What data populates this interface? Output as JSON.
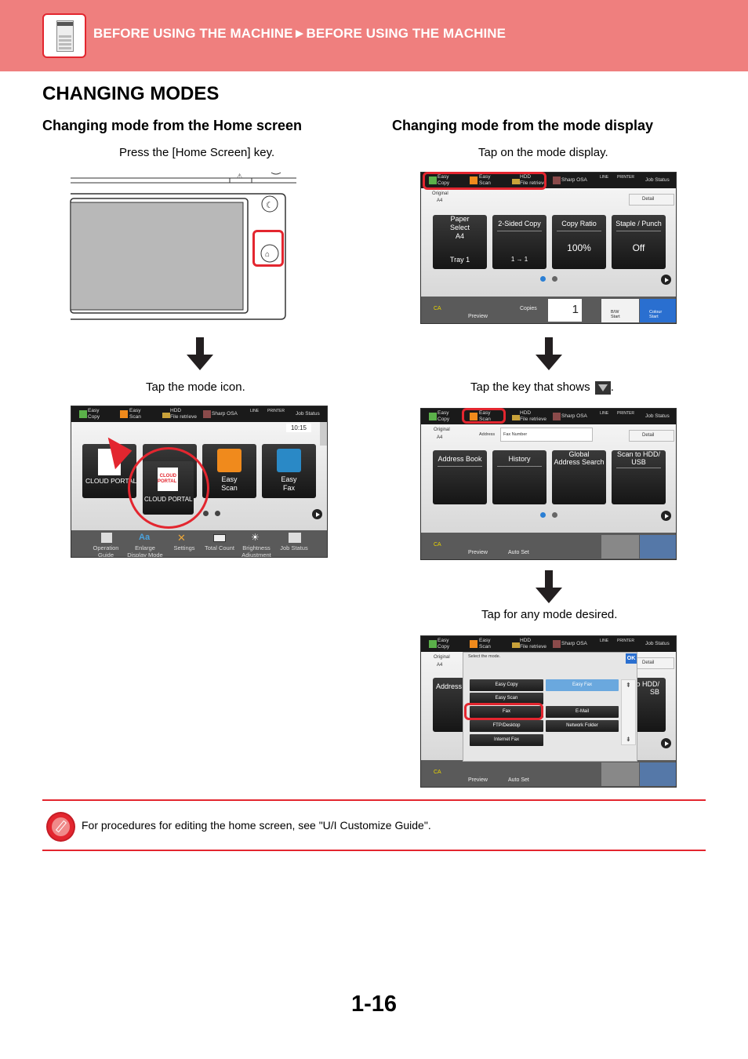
{
  "header": {
    "breadcrumb": "BEFORE USING THE MACHINE►BEFORE USING THE MACHINE",
    "icon": "multifunction-printer-icon",
    "background_color": "#ef7f7e",
    "accent_color": "#e3262f"
  },
  "title": "CHANGING MODES",
  "left": {
    "heading": "Changing mode from the Home screen",
    "step1": "Press the [Home Screen] key.",
    "step2": "Tap the mode icon.",
    "home_screen": {
      "topbar": {
        "easy_copy": "Easy\nCopy",
        "easy_scan": "Easy\nScan",
        "hdd": "HDD\nFile retrieve",
        "sharp_osa": "Sharp OSA",
        "line": "LINE",
        "printer": "PRINTER",
        "job_status": "Job Status"
      },
      "clock": "10:15",
      "tiles": [
        "CLOUD PORTAL",
        "CLOUD PORTAL",
        "Easy Scan",
        "Easy Fax"
      ],
      "tile_logo": "CLOUD\nPORTAL",
      "easy_scan": [
        "Easy",
        "Scan"
      ],
      "easy_fax": [
        "Easy",
        "Fax"
      ],
      "bottom": [
        "Operation Guide",
        "Enlarge Display Mode",
        "Settings",
        "Total Count",
        "Brightness Adjustment",
        "Job Status"
      ],
      "bottom_lines": [
        [
          "Operation",
          "Guide"
        ],
        [
          "Enlarge",
          "Display Mode"
        ],
        [
          "Settings",
          ""
        ],
        [
          "Total Count",
          ""
        ],
        [
          "Brightness",
          "Adjustment"
        ],
        [
          "Job Status",
          ""
        ]
      ]
    }
  },
  "right": {
    "heading": "Changing mode from the mode display",
    "step1": "Tap on the mode display.",
    "step2_prefix": "Tap the key that shows",
    "step2_suffix": ".",
    "step3": "Tap for any mode desired.",
    "copy_screen": {
      "original": "Original",
      "original_size": "A4",
      "detail": "Detail",
      "tiles": [
        {
          "title": "Paper\nSelect",
          "line1": "A4",
          "line2": "Tray 1"
        },
        {
          "title": "2-Sided Copy",
          "line2": "1 → 1"
        },
        {
          "title": "Copy Ratio",
          "value": "100%"
        },
        {
          "title": "Staple / Punch",
          "value": "Off"
        }
      ],
      "ca": "CA",
      "preview": "Preview",
      "copies_label": "Copies",
      "copies_value": "1",
      "bw_start": "B/W\nStart",
      "colour_start": "Colour\nStart"
    },
    "fax_screen": {
      "original": "Original",
      "original_size": "A4",
      "address_label": "Address",
      "address_placeholder": "Fax Number",
      "detail": "Detail",
      "tiles": [
        "Address Book",
        "History",
        "Global\nAddress Search",
        "Scan to HDD/\nUSB"
      ],
      "ca": "CA",
      "preview": "Preview",
      "auto_set": "Auto Set"
    },
    "mode_select": {
      "prompt": "Select the mode.",
      "ok": "OK",
      "address_partial": "Address",
      "hdd_partial": "o HDD/\nSB",
      "left_col": [
        "Easy Copy",
        "Easy Scan",
        "Fax",
        "FTP/Desktop",
        "Internet Fax"
      ],
      "right_col": [
        "Easy Fax",
        "E-Mail",
        "Network Folder"
      ],
      "selected": "Fax"
    }
  },
  "note": {
    "icon": "pencil-note-icon",
    "text": "For procedures for editing the home screen, see \"U/I Customize Guide\"."
  },
  "page_number": "1-16"
}
